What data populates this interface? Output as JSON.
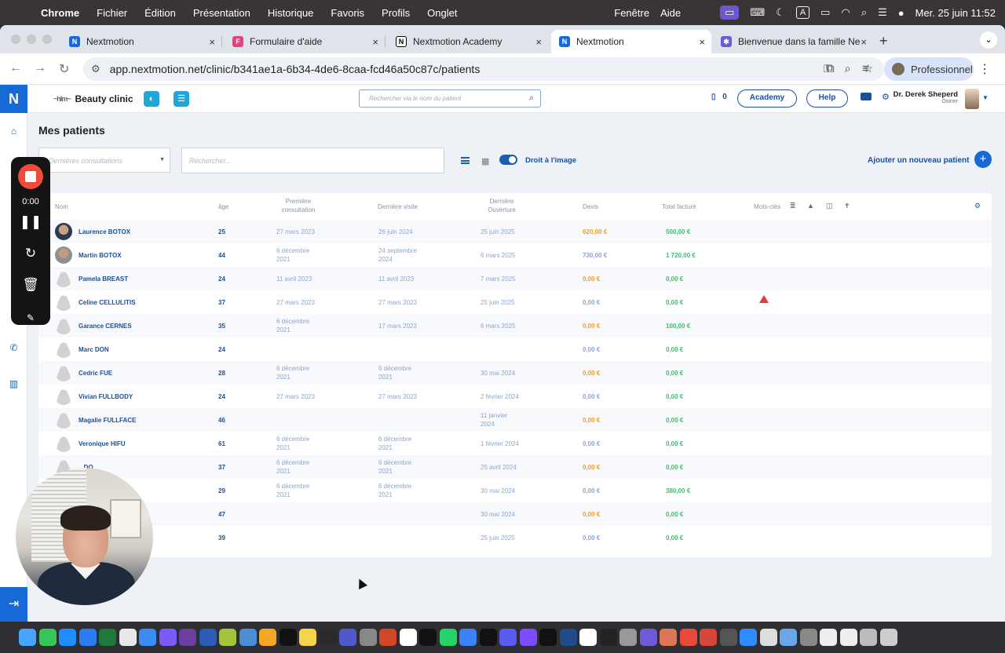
{
  "menubar": {
    "app": "Chrome",
    "items": [
      "Fichier",
      "Édition",
      "Présentation",
      "Historique",
      "Favoris",
      "Profils",
      "Onglet"
    ],
    "right_items": [
      "Fenêtre",
      "Aide"
    ],
    "clock": "Mer. 25 juin  11:52",
    "keyboard_indicator": "A"
  },
  "tabs": [
    {
      "title": "Nextmotion",
      "icon": "nextmotion-icon"
    },
    {
      "title": "Formulaire d'aide",
      "icon": "form-icon"
    },
    {
      "title": "Nextmotion Academy",
      "icon": "notion-icon"
    },
    {
      "title": "Nextmotion",
      "icon": "nextmotion-icon",
      "active": true
    },
    {
      "title": "Bienvenue dans la famille Ne",
      "icon": "asterisk-icon"
    }
  ],
  "address_bar": {
    "url": "app.nextmotion.net/clinic/b341ae1a-6b34-4de6-8caa-fcd46a50c87c/patients",
    "profile": "Professionnel"
  },
  "app_header": {
    "logo": "N",
    "clinic_logo_text": "~hlm~",
    "clinic_name": "Beauty clinic",
    "search_placeholder": "Rechercher via le nom du patient",
    "device_count": "0",
    "academy_label": "Academy",
    "help_label": "Help",
    "doctor_name": "Dr. Derek Sheperd",
    "doctor_role": "Owner"
  },
  "page": {
    "title": "Mes patients",
    "filter_placeholder": "Dernières consultations",
    "search_placeholder": "Rechercher...",
    "image_rights_label": "Droit à l'image",
    "add_patient_label": "Ajouter un nouveau patient"
  },
  "table": {
    "headers": {
      "name": "Nom",
      "age": "âge",
      "first_consult_1": "Première",
      "first_consult_2": "consultation",
      "last_visit": "Dernière visite",
      "last_open_1": "Dernière",
      "last_open_2": "Ouverture",
      "quote": "Devis",
      "total": "Total facturé",
      "keywords": "Mots-clés"
    },
    "rows": [
      {
        "name": "Laurence BOTOX",
        "age": "25",
        "first": [
          "27 mars 2023"
        ],
        "last": [
          "26 juin 2024"
        ],
        "open": [
          "25 juin 2025"
        ],
        "devis": "620,00 €",
        "devis_color": "#f0a020",
        "total": "500,00 €",
        "avatar": "p1"
      },
      {
        "name": "Martin BOTOX",
        "age": "44",
        "first": [
          "6 décembre",
          "2021"
        ],
        "last": [
          "24 septembre",
          "2024"
        ],
        "open": [
          "6 mars 2025"
        ],
        "devis": "730,00 €",
        "devis_color": "#8aa6cf",
        "total": "1 720,00 €",
        "avatar": "p2"
      },
      {
        "name": "Pamela BREAST",
        "age": "24",
        "first": [
          "11 avril 2023"
        ],
        "last": [
          "11 avril 2023"
        ],
        "open": [
          "7 mars 2025"
        ],
        "devis": "0,00 €",
        "devis_color": "#f0a020",
        "total": "0,00 €",
        "avatar": "gray"
      },
      {
        "name": "Celine CELLULITIS",
        "age": "37",
        "first": [
          "27 mars 2023"
        ],
        "last": [
          "27 mars 2023"
        ],
        "open": [
          "25 juin 2025"
        ],
        "devis": "0,00 €",
        "devis_color": "#8aa6cf",
        "total": "0,00 €",
        "avatar": "gray",
        "warning": true
      },
      {
        "name": "Garance CERNES",
        "age": "35",
        "first": [
          "6 décembre",
          "2021"
        ],
        "last": [
          "17 mars 2023"
        ],
        "open": [
          "6 mars 2025"
        ],
        "devis": "0,00 €",
        "devis_color": "#f0a020",
        "total": "100,00 €",
        "avatar": "gray"
      },
      {
        "name": "Marc DON",
        "age": "24",
        "first": [],
        "last": [],
        "open": [],
        "devis": "0,00 €",
        "devis_color": "#8aa6cf",
        "total": "0,00 €",
        "avatar": "gray"
      },
      {
        "name": "Cedric FUE",
        "age": "28",
        "first": [
          "6 décembre",
          "2021"
        ],
        "last": [
          "6 décembre",
          "2021"
        ],
        "open": [
          "30 mai 2024"
        ],
        "devis": "0,00 €",
        "devis_color": "#f0a020",
        "total": "0,00 €",
        "avatar": "gray"
      },
      {
        "name": "Vivian FULLBODY",
        "age": "24",
        "first": [
          "27 mars 2023"
        ],
        "last": [
          "27 mars 2023"
        ],
        "open": [
          "2 février 2024"
        ],
        "devis": "0,00 €",
        "devis_color": "#8aa6cf",
        "total": "0,00 €",
        "avatar": "gray"
      },
      {
        "name": "Magalie FULLFACE",
        "age": "46",
        "first": [],
        "last": [],
        "open": [
          "11 janvier",
          "2024"
        ],
        "devis": "0,00 €",
        "devis_color": "#f0a020",
        "total": "0,00 €",
        "avatar": "gray"
      },
      {
        "name": "Veronique HIFU",
        "age": "61",
        "first": [
          "6 décembre",
          "2021"
        ],
        "last": [
          "6 décembre",
          "2021"
        ],
        "open": [
          "1 février 2024"
        ],
        "devis": "0,00 €",
        "devis_color": "#8aa6cf",
        "total": "0,00 €",
        "avatar": "gray"
      },
      {
        "name": "...DO",
        "age": "37",
        "first": [
          "6 décembre",
          "2021"
        ],
        "last": [
          "6 décembre",
          "2021"
        ],
        "open": [
          "25 avril 2024"
        ],
        "devis": "0,00 €",
        "devis_color": "#f0a020",
        "total": "0,00 €",
        "avatar": "gray"
      },
      {
        "name": "",
        "age": "29",
        "first": [
          "6 décembre",
          "2021"
        ],
        "last": [
          "6 décembre",
          "2021"
        ],
        "open": [
          "30 mai 2024"
        ],
        "devis": "0,00 €",
        "devis_color": "#8aa6cf",
        "total": "380,00 €",
        "avatar": "none"
      },
      {
        "name": "",
        "age": "47",
        "first": [],
        "last": [],
        "open": [
          "30 mai 2024"
        ],
        "devis": "0,00 €",
        "devis_color": "#f0a020",
        "total": "0,00 €",
        "avatar": "none"
      },
      {
        "name": "",
        "age": "39",
        "first": [],
        "last": [],
        "open": [
          "25 juin 2025"
        ],
        "devis": "0,00 €",
        "devis_color": "#8aa6cf",
        "total": "0,00 €",
        "avatar": "none"
      }
    ]
  },
  "recorder": {
    "time": "0:00"
  },
  "colors": {
    "brand": "#1769d6",
    "link": "#1a4f9a",
    "green": "#3cc168",
    "orange": "#f0a020",
    "muted": "#8aa6cf"
  },
  "dock_icons": [
    "finder-icon",
    "messages-icon",
    "appstore-icon",
    "keynote-icon",
    "excel-icon",
    "chrome-icon",
    "safari-icon",
    "figma-icon",
    "affinity-icon",
    "word-icon",
    "pineapple-icon",
    "quicktime-icon",
    "photos-icon",
    "chatgpt-icon",
    "notes-icon",
    "claquette-icon",
    "teams-icon",
    "screenshot-icon",
    "powerpoint-icon",
    "calendar-icon",
    "capcut-icon",
    "whatsapp-icon",
    "frame-icon",
    "tiktok-icon",
    "arc-icon",
    "app-icon",
    "chatgpt2-icon",
    "photoshop-icon",
    "notion-icon",
    "terminal-icon",
    "edit-icon",
    "asterisk-icon",
    "claude-icon",
    "spark-icon",
    "mail-icon",
    "calculator-icon",
    "zoom-icon",
    "preview-icon",
    "folder-icon",
    "stage-icon",
    "doc-icon",
    "doc2-icon",
    "window-icon",
    "trash-icon"
  ]
}
